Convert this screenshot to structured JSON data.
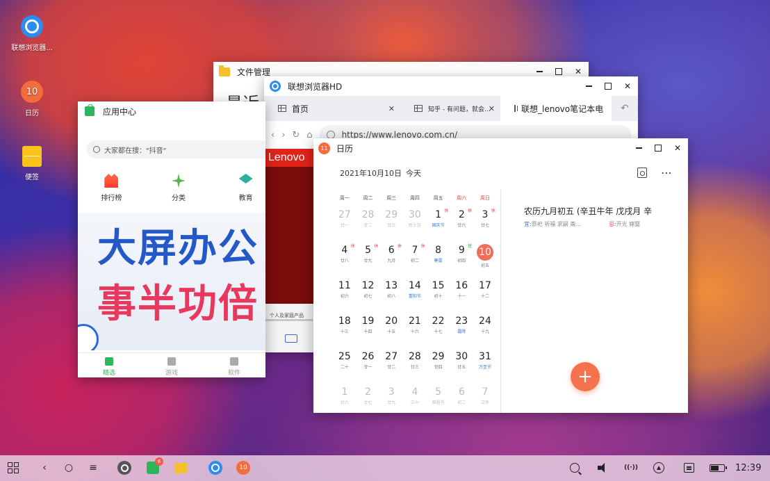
{
  "desktop": {
    "icons": [
      {
        "label": "联想浏览器..."
      },
      {
        "label": "日历",
        "badge": "10"
      },
      {
        "label": "便签"
      }
    ]
  },
  "file_manager": {
    "title": "文件管理",
    "partial_text": "最近"
  },
  "browser": {
    "title": "联想浏览器HD",
    "tabs": [
      {
        "label": "首页"
      },
      {
        "label": "知乎 - 有问题，就会..."
      },
      {
        "label": "联想_lenovo笔记本电"
      }
    ],
    "url": "https://www.lenovo.com.cn/",
    "brand": "Lenovo",
    "strip_text": "个人及家庭产品"
  },
  "app_center": {
    "title": "应用中心",
    "search_placeholder": "大家都在搜：\"抖音\"",
    "categories": [
      "排行榜",
      "分类",
      "教育"
    ],
    "banner_line1": "大屏办公",
    "banner_line2": "事半功倍",
    "nav": [
      "精选",
      "游戏",
      "软件"
    ]
  },
  "calendar": {
    "title": "日历",
    "badge": "11",
    "header_date": "2021年10月10日",
    "header_today": "今天",
    "weekdays": [
      "周一",
      "周二",
      "周三",
      "周四",
      "周五",
      "周六",
      "周日"
    ],
    "weeks": [
      [
        {
          "n": "27",
          "l": "廿一",
          "dim": true
        },
        {
          "n": "28",
          "l": "廿二",
          "dim": true
        },
        {
          "n": "29",
          "l": "廿三",
          "dim": true
        },
        {
          "n": "30",
          "l": "烈士日",
          "dim": true
        },
        {
          "n": "1",
          "l": "国庆节",
          "mk": "休",
          "blue": true
        },
        {
          "n": "2",
          "l": "廿六",
          "mk": "休"
        },
        {
          "n": "3",
          "l": "廿七",
          "mk": "休"
        }
      ],
      [
        {
          "n": "4",
          "l": "廿八",
          "mk": "休"
        },
        {
          "n": "5",
          "l": "廿九",
          "mk": "休"
        },
        {
          "n": "6",
          "l": "九月",
          "mk": "休"
        },
        {
          "n": "7",
          "l": "初二",
          "mk": "休"
        },
        {
          "n": "8",
          "l": "寒露",
          "blue": true
        },
        {
          "n": "9",
          "l": "初四",
          "mk": "班",
          "green": true
        },
        {
          "n": "10",
          "l": "初五",
          "today": true
        }
      ],
      [
        {
          "n": "11",
          "l": "初六"
        },
        {
          "n": "12",
          "l": "初七"
        },
        {
          "n": "13",
          "l": "初八"
        },
        {
          "n": "14",
          "l": "重阳节",
          "blue": true
        },
        {
          "n": "15",
          "l": "初十"
        },
        {
          "n": "16",
          "l": "十一"
        },
        {
          "n": "17",
          "l": "十二"
        }
      ],
      [
        {
          "n": "18",
          "l": "十三"
        },
        {
          "n": "19",
          "l": "十四"
        },
        {
          "n": "20",
          "l": "十五"
        },
        {
          "n": "21",
          "l": "十六"
        },
        {
          "n": "22",
          "l": "十七"
        },
        {
          "n": "23",
          "l": "霜降",
          "blue": true
        },
        {
          "n": "24",
          "l": "十九"
        }
      ],
      [
        {
          "n": "25",
          "l": "二十"
        },
        {
          "n": "26",
          "l": "廿一"
        },
        {
          "n": "27",
          "l": "廿二"
        },
        {
          "n": "28",
          "l": "廿三"
        },
        {
          "n": "29",
          "l": "廿四"
        },
        {
          "n": "30",
          "l": "廿五"
        },
        {
          "n": "31",
          "l": "万圣节",
          "blue": true
        }
      ],
      [
        {
          "n": "1",
          "l": "廿六",
          "dim": true
        },
        {
          "n": "2",
          "l": "廿七",
          "dim": true
        },
        {
          "n": "3",
          "l": "廿九",
          "dim": true
        },
        {
          "n": "4",
          "l": "三十",
          "dim": true
        },
        {
          "n": "5",
          "l": "祭祖节",
          "dim": true
        },
        {
          "n": "6",
          "l": "初二",
          "dim": true
        },
        {
          "n": "7",
          "l": "立冬",
          "dim": true
        }
      ]
    ],
    "lunar_title": "农历九月初五 (辛丑牛年 戊戌月 辛",
    "yi_label": "宜:",
    "yi": "祭祀 祈福 求嗣 斋...",
    "ji_label": "忌:",
    "ji": "开光 嫁娶",
    "fab": "+"
  },
  "taskbar": {
    "store_badge": "6",
    "calendar_label": "10",
    "battery_level": 0.6,
    "clock": "12:39",
    "back": "‹",
    "home": "○",
    "menu": "≡",
    "wifi": "((·))"
  }
}
